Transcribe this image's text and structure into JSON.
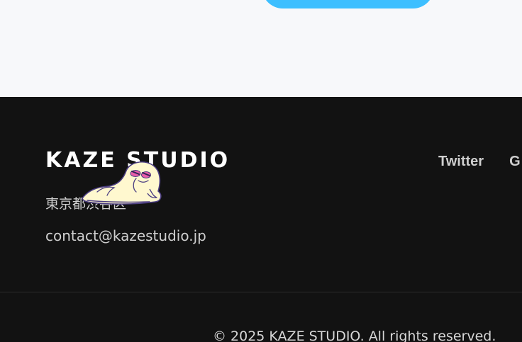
{
  "top": {
    "button_label": ""
  },
  "footer": {
    "brand": "KAZE STUDIO",
    "address": "東京都渋谷区",
    "email": "contact@kazestudio.jp",
    "social_links": [
      {
        "label": "Twitter"
      },
      {
        "label": "G"
      }
    ],
    "copyright": "© 2025 KAZE STUDIO. All rights reserved."
  },
  "colors": {
    "accent": "#3dbfff",
    "footer_background": "#121212",
    "page_background": "#f7f8fa"
  },
  "icons": {
    "mascot": "reclining-ghost-mascot-icon"
  }
}
